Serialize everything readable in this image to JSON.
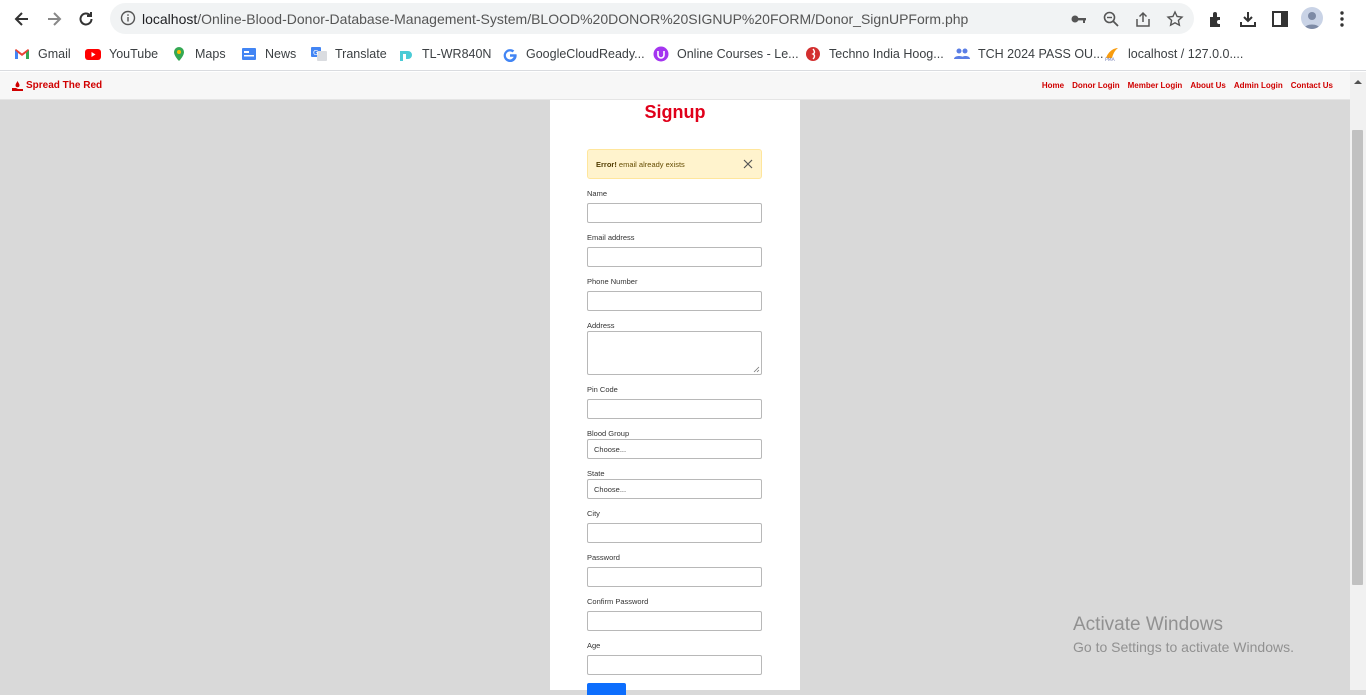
{
  "browser": {
    "url_host": "localhost",
    "url_path": "/Online-Blood-Donor-Database-Management-System/BLOOD%20DONOR%20SIGNUP%20FORM/Donor_SignUPForm.php",
    "bookmarks": [
      {
        "label": "Gmail",
        "icon": "gmail-icon"
      },
      {
        "label": "YouTube",
        "icon": "youtube-icon"
      },
      {
        "label": "Maps",
        "icon": "maps-icon"
      },
      {
        "label": "News",
        "icon": "news-icon"
      },
      {
        "label": "Translate",
        "icon": "translate-icon"
      },
      {
        "label": "TL-WR840N",
        "icon": "tplink-icon"
      },
      {
        "label": "GoogleCloudReady...",
        "icon": "google-icon"
      },
      {
        "label": "Online Courses - Le...",
        "icon": "udemy-icon"
      },
      {
        "label": "Techno India Hoog...",
        "icon": "techno-icon"
      },
      {
        "label": "TCH 2024 PASS OU...",
        "icon": "group-icon"
      },
      {
        "label": "localhost / 127.0.0....",
        "icon": "phpmyadmin-icon"
      }
    ]
  },
  "site": {
    "brand": "Spread The Red",
    "nav": [
      "Home",
      "Donor Login",
      "Member Login",
      "About Us",
      "Admin Login",
      "Contact Us"
    ]
  },
  "form": {
    "title": "Signup",
    "alert_strong": "Error!",
    "alert_text": " email already exists",
    "fields": {
      "name": "Name",
      "email": "Email address",
      "phone": "Phone Number",
      "address": "Address",
      "pin": "Pin Code",
      "blood": "Blood Group",
      "state": "State",
      "city": "City",
      "password": "Password",
      "confirm": "Confirm Password",
      "age": "Age"
    },
    "blood_selected": "Choose...",
    "state_selected": "Choose..."
  },
  "watermark": {
    "line1": "Activate Windows",
    "line2": "Go to Settings to activate Windows."
  },
  "colors": {
    "accent": "#e0001a",
    "button": "#0d6efd",
    "alert_bg": "#fff3cd"
  }
}
